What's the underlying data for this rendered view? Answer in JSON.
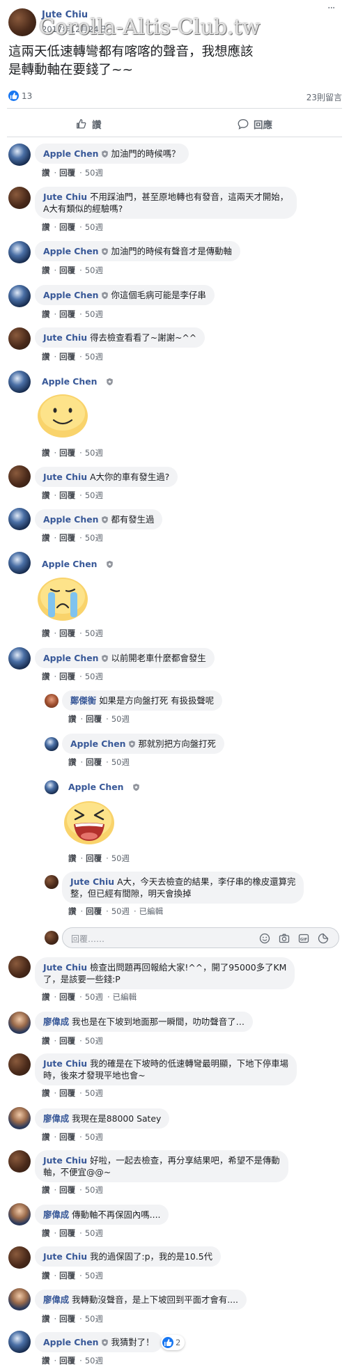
{
  "post": {
    "author": "Jute Chiu",
    "date": "2017年12月24日",
    "text_line1": "這兩天低速轉彎都有喀喀的聲音，我想應該",
    "text_line2": "是轉動軸在要錢了~~",
    "watermark": "Corolla-Altis-Club.tw",
    "like_count": "13",
    "comment_count": "23則留言",
    "menu_glyph": "···"
  },
  "actions": {
    "like_label": "讚",
    "comment_label": "回應"
  },
  "common": {
    "like": "讚",
    "reply": "回覆",
    "edited": "已編輯"
  },
  "comments": [
    {
      "author": "Apple Chen",
      "text": "加油門的時候嗎？",
      "time": "50週"
    },
    {
      "author": "Jute Chiu",
      "text1": "不用踩油門，甚至原地轉也有發音，這兩天才開始，",
      "text2": "A大有類似的經驗嗎?",
      "time": "50週"
    },
    {
      "author": "Apple Chen",
      "text": "加油門的時候有聲音才是傳動軸",
      "time": "50週"
    },
    {
      "author": "Apple Chen",
      "text": "你這個毛病可能是李仔串",
      "time": "50週"
    },
    {
      "author": "Jute Chiu",
      "text": "得去檢查看看了~謝謝~^^",
      "time": "50週"
    },
    {
      "author": "Apple Chen",
      "time": "50週"
    },
    {
      "author": "Jute Chiu",
      "text": "A大你的車有發生過?",
      "time": "50週"
    },
    {
      "author": "Apple Chen",
      "text": "都有發生過",
      "time": "50週"
    },
    {
      "author": "Apple Chen",
      "time": "50週"
    },
    {
      "author": "Apple Chen",
      "text": "以前開老車什麼都會發生",
      "time": "50週"
    }
  ],
  "replies": [
    {
      "author": "鄭傑衡",
      "text": "如果是方向盤打死 有扱扱聲呢",
      "time": "50週"
    },
    {
      "author": "Apple Chen",
      "text": "那就別把方向盤打死",
      "time": "50週"
    },
    {
      "author": "Apple Chen",
      "time": "50週"
    },
    {
      "author": "Jute Chiu",
      "text1": "A大，今天去檢查的結果，李仔串的橡皮還算完",
      "text2": "整，但已經有間隙，明天會換掉",
      "time": "50週"
    }
  ],
  "reply_input": {
    "placeholder": "回覆……"
  },
  "comments2": [
    {
      "author": "Jute Chiu",
      "text1": "檢查出問題再回報給大家!^^，開了95000多了KM",
      "text2": "了，是該要一些錢:P",
      "time": "50週"
    },
    {
      "author": "廖偉成",
      "text": "我也是在下坡到地面那一瞬間，叻叻聲音了…",
      "time": "50週"
    },
    {
      "author": "Jute Chiu",
      "text1": "我的確是在下坡時的低速轉彎最明顯，下地下停車場",
      "text2": "時，後來才發現平地也會~",
      "time": "50週"
    },
    {
      "author": "廖偉成",
      "text": "我現在是88000 Satey",
      "time": "50週"
    },
    {
      "author": "Jute Chiu",
      "text1": "好啦，一起去檢查，再分享結果吧，希望不是傳動",
      "text2": "軸，不便宜@@~",
      "time": "50週"
    },
    {
      "author": "廖偉成",
      "text": "傳動軸不再保固內嗎....",
      "time": "50週"
    },
    {
      "author": "Jute Chiu",
      "text": "我的過保固了:p，我的是10.5代",
      "time": "50週"
    },
    {
      "author": "廖偉成",
      "text": "我轉動沒聲音，是上下坡回到平面才會有....",
      "time": "50週"
    },
    {
      "author": "Apple Chen",
      "text": "我猜對了！",
      "time": "50週",
      "reactions": "2"
    }
  ],
  "colors": {
    "link": "#385898",
    "bubble": "#f2f3f5",
    "like_blue": "#1877f2"
  }
}
